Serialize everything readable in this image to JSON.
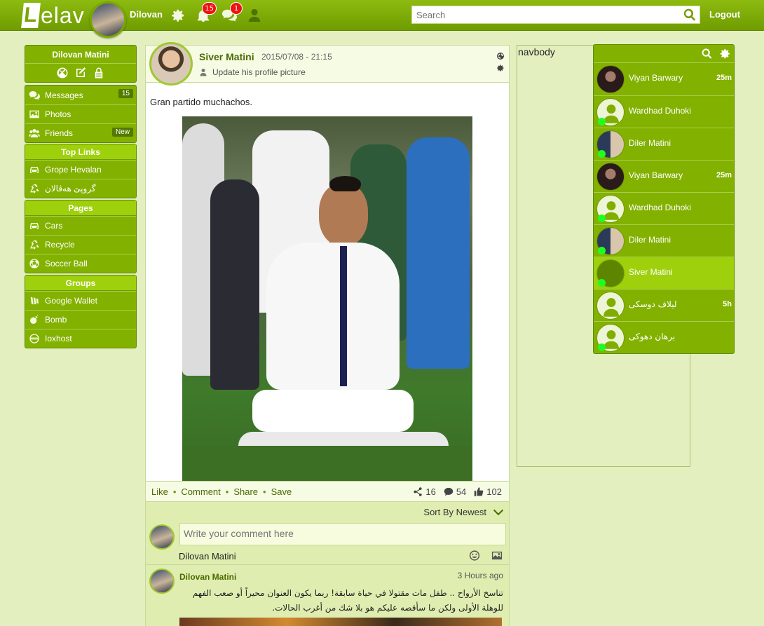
{
  "header": {
    "logo_initial": "L",
    "logo_rest": "elav",
    "user_name": "Dilovan",
    "notifications_count": "15",
    "messages_count": "1",
    "search_placeholder": "Search",
    "logout_label": "Logout",
    "accent_color": "#79a500"
  },
  "sidebar": {
    "profile_name": "Dilovan Matini",
    "main_items": [
      {
        "label": "Messages",
        "icon": "chat-bubbles-icon",
        "count": "15"
      },
      {
        "label": "Photos",
        "icon": "image-icon"
      },
      {
        "label": "Friends",
        "icon": "users-icon",
        "count": "New"
      }
    ],
    "top_links_title": "Top Links",
    "top_links": [
      {
        "label": "Grope Hevalan",
        "icon": "car-icon"
      },
      {
        "label": "گروپێ هەڤالان",
        "icon": "recycle-icon"
      }
    ],
    "pages_title": "Pages",
    "pages": [
      {
        "label": "Cars",
        "icon": "car-icon"
      },
      {
        "label": "Recycle",
        "icon": "recycle-icon"
      },
      {
        "label": "Soccer Ball",
        "icon": "soccer-ball-icon"
      }
    ],
    "groups_title": "Groups",
    "groups": [
      {
        "label": "Google Wallet",
        "icon": "wallet-icon"
      },
      {
        "label": "Bomb",
        "icon": "bomb-icon"
      },
      {
        "label": "Ioxhost",
        "icon": "ioxhost-icon"
      }
    ]
  },
  "post": {
    "author": "Siver Matini",
    "date": "2015/07/08 - 21:15",
    "action": "Update his profile picture",
    "text": "Gran partido muchachos.",
    "actions": {
      "like": "Like",
      "comment": "Comment",
      "share": "Share",
      "save": "Save"
    },
    "stats": {
      "shares": "16",
      "comments": "54",
      "likes": "102"
    },
    "sort_label": "Sort By Newest",
    "comment_placeholder": "Write your comment here",
    "composer_name": "Dilovan Matini",
    "comment": {
      "author": "Dilovan Matini",
      "time": "3 Hours ago",
      "line1": "تناسخ الأرواح .. طفل مات مقتولا في حياة سابقة! ربما يكون العنوان محيراً أو صعب الفهم",
      "line2": "للوهلة الأولى ولكن ما سأقصه عليكم هو بلا شك من أغرب الحالات."
    }
  },
  "navbody_label": "navbody",
  "chat": {
    "online_color": "#1fff1f",
    "contacts": [
      {
        "name": "Viyan Barwary",
        "time": "25m",
        "avatar": "dark",
        "online": false
      },
      {
        "name": "Wardhad Duhoki",
        "time": "",
        "avatar": "male",
        "online": true
      },
      {
        "name": "Diler Matini",
        "time": "",
        "avatar": "pair",
        "online": true
      },
      {
        "name": "Viyan Barwary",
        "time": "25m",
        "avatar": "dark",
        "online": false
      },
      {
        "name": "Wardhad Duhoki",
        "time": "",
        "avatar": "male",
        "online": true
      },
      {
        "name": "Diler Matini",
        "time": "",
        "avatar": "pair",
        "online": true
      },
      {
        "name": "Siver Matini",
        "time": "",
        "avatar": "green",
        "online": true,
        "active": true
      },
      {
        "name": "ليلاف دوسكى",
        "time": "5h",
        "avatar": "female",
        "online": false,
        "rtl": true
      },
      {
        "name": "برهان دهوكى",
        "time": "",
        "avatar": "male",
        "online": true,
        "rtl": true
      }
    ]
  }
}
